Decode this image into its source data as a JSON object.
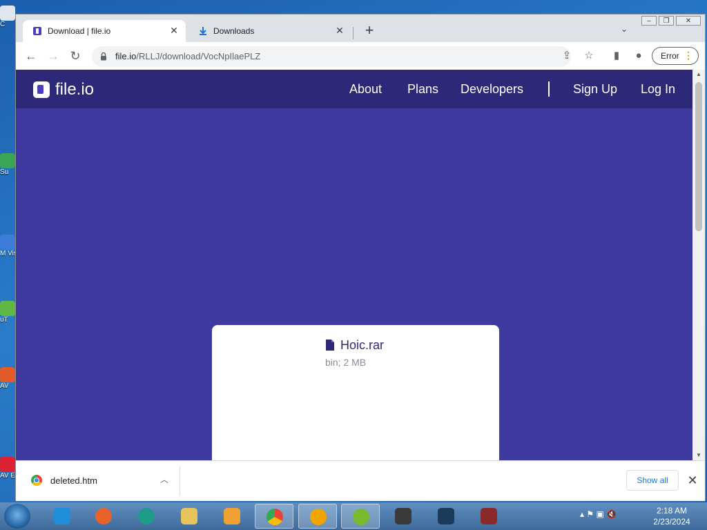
{
  "desktop": {
    "icons": [
      {
        "label": "C"
      },
      {
        "label": "Su"
      },
      {
        "label": "M Vis"
      },
      {
        "label": "uT"
      },
      {
        "label": "AV"
      },
      {
        "label": "AV E"
      }
    ]
  },
  "browser": {
    "tabs": [
      {
        "title": "Download | file.io",
        "active": true
      },
      {
        "title": "Downloads",
        "active": false
      }
    ],
    "new_tab_label": "+",
    "url": {
      "host": "file.io",
      "path": "/RLLJ/download/VocNpIlaePLZ"
    },
    "error_button": "Error"
  },
  "site": {
    "logo_text": "file.io",
    "nav": {
      "about": "About",
      "plans": "Plans",
      "developers": "Developers",
      "signup": "Sign Up",
      "login": "Log In"
    },
    "file": {
      "name": "Hoic.rar",
      "meta": "bin; 2 MB"
    },
    "colors": {
      "nav": "#2d2877",
      "hero": "#3f3aa0"
    }
  },
  "download_shelf": {
    "item_name": "deleted.htm",
    "show_all": "Show all"
  },
  "taskbar": {
    "apps": [
      "internet-explorer",
      "firefox",
      "edge-like",
      "file-explorer",
      "media-player",
      "chrome",
      "browser-icon",
      "utorrent",
      "world-of-tanks",
      "world-of-warships",
      "game-icon"
    ],
    "clock": {
      "time": "2:18 AM",
      "date": "2/23/2024"
    }
  }
}
